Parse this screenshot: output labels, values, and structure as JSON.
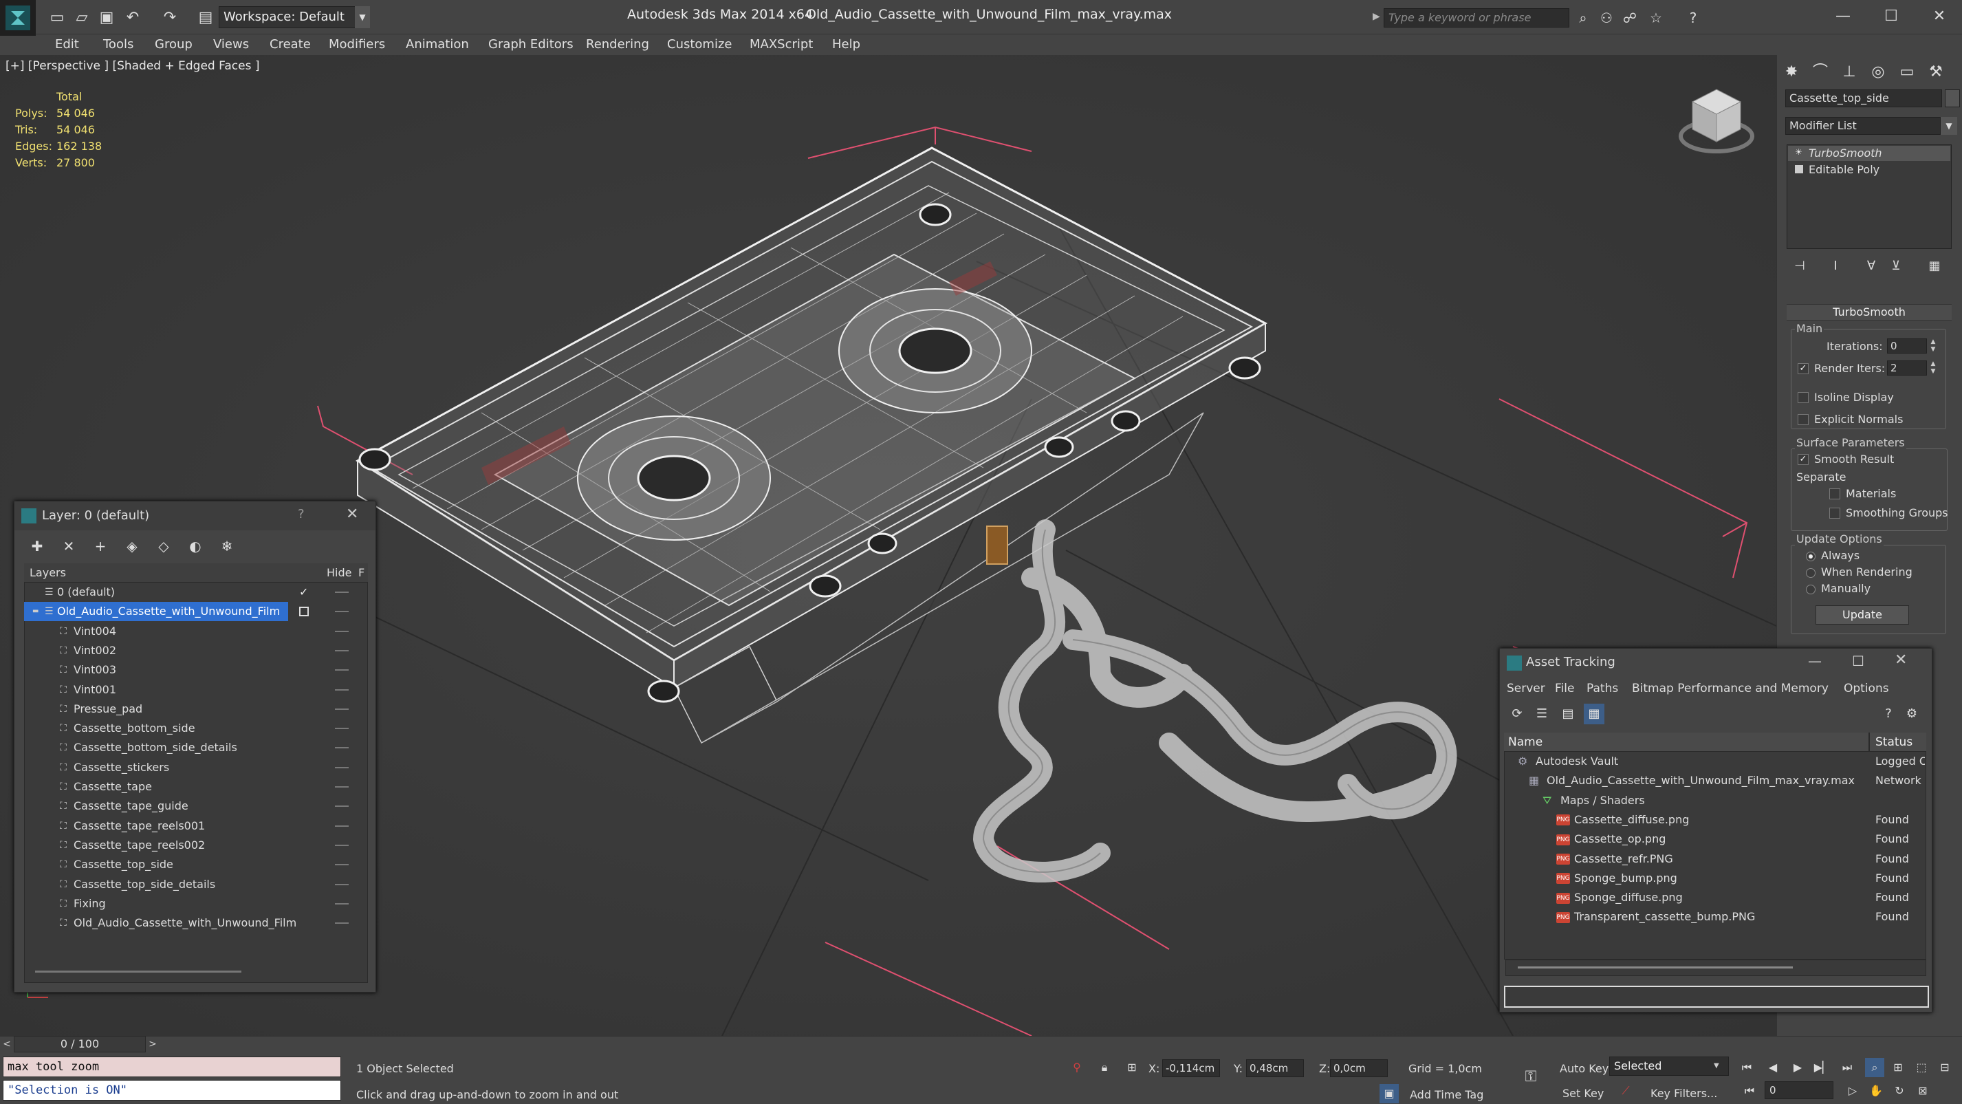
{
  "app": {
    "title": "Autodesk 3ds Max  2014 x64",
    "file": "Old_Audio_Cassette_with_Unwound_Film_max_vray.max",
    "workspace": "Workspace: Default",
    "search_placeholder": "Type a keyword or phrase"
  },
  "menu": [
    "Edit",
    "Tools",
    "Group",
    "Views",
    "Create",
    "Modifiers",
    "Animation",
    "Graph Editors",
    "Rendering",
    "Customize",
    "MAXScript",
    "Help"
  ],
  "viewport": {
    "label": "[+] [Perspective ] [Shaded + Edged Faces ]",
    "stats": {
      "header": "Total",
      "rows": [
        {
          "label": "Polys:",
          "value": "54 046"
        },
        {
          "label": "Tris:",
          "value": "54 046"
        },
        {
          "label": "Edges:",
          "value": "162 138"
        },
        {
          "label": "Verts:",
          "value": "27 800"
        }
      ]
    }
  },
  "command_panel": {
    "object_name": "Cassette_top_side",
    "modifier_list": "Modifier List",
    "stack": [
      "TurboSmooth",
      "Editable Poly"
    ],
    "rollout_title": "TurboSmooth",
    "main_group": "Main",
    "iterations_label": "Iterations:",
    "iterations_value": "0",
    "render_iters_label": "Render Iters:",
    "render_iters_value": "2",
    "isoline_label": "Isoline Display",
    "explicit_normals_label": "Explicit Normals",
    "surface_group": "Surface Parameters",
    "smooth_result_label": "Smooth Result",
    "separate_label": "Separate",
    "materials_label": "Materials",
    "smoothing_groups_label": "Smoothing Groups",
    "update_group": "Update Options",
    "always_label": "Always",
    "when_rendering_label": "When Rendering",
    "manually_label": "Manually",
    "update_button": "Update"
  },
  "layer_window": {
    "title": "Layer: 0 (default)",
    "help": "?",
    "col_layers": "Layers",
    "col_hide": "Hide",
    "col_f": "F",
    "rows": [
      {
        "name": "0 (default)",
        "level": 0
      },
      {
        "name": "Old_Audio_Cassette_with_Unwound_Film",
        "level": 0
      },
      {
        "name": "Vint004",
        "level": 1
      },
      {
        "name": "Vint002",
        "level": 1
      },
      {
        "name": "Vint003",
        "level": 1
      },
      {
        "name": "Vint001",
        "level": 1
      },
      {
        "name": "Pressue_pad",
        "level": 1
      },
      {
        "name": "Cassette_bottom_side",
        "level": 1
      },
      {
        "name": "Cassette_bottom_side_details",
        "level": 1
      },
      {
        "name": "Cassette_stickers",
        "level": 1
      },
      {
        "name": "Cassette_tape",
        "level": 1
      },
      {
        "name": "Cassette_tape_guide",
        "level": 1
      },
      {
        "name": "Cassette_tape_reels001",
        "level": 1
      },
      {
        "name": "Cassette_tape_reels002",
        "level": 1
      },
      {
        "name": "Cassette_top_side",
        "level": 1
      },
      {
        "name": "Cassette_top_side_details",
        "level": 1
      },
      {
        "name": "Fixing",
        "level": 1
      },
      {
        "name": "Old_Audio_Cassette_with_Unwound_Film",
        "level": 1
      }
    ]
  },
  "asset_window": {
    "title": "Asset Tracking",
    "menu": [
      "Server",
      "File",
      "Paths",
      "Bitmap Performance and Memory",
      "Options"
    ],
    "col_name": "Name",
    "col_status": "Status",
    "rows": [
      {
        "name": "Autodesk Vault",
        "status": "Logged O",
        "level": 0,
        "kind": "vault"
      },
      {
        "name": "Old_Audio_Cassette_with_Unwound_Film_max_vray.max",
        "status": "Network",
        "level": 1,
        "kind": "max"
      },
      {
        "name": "Maps / Shaders",
        "status": "",
        "level": 2,
        "kind": "maps"
      },
      {
        "name": "Cassette_diffuse.png",
        "status": "Found",
        "level": 3,
        "kind": "png"
      },
      {
        "name": "Cassette_op.png",
        "status": "Found",
        "level": 3,
        "kind": "png"
      },
      {
        "name": "Cassette_refr.PNG",
        "status": "Found",
        "level": 3,
        "kind": "png"
      },
      {
        "name": "Sponge_bump.png",
        "status": "Found",
        "level": 3,
        "kind": "png"
      },
      {
        "name": "Sponge_diffuse.png",
        "status": "Found",
        "level": 3,
        "kind": "png"
      },
      {
        "name": "Transparent_cassette_bump.PNG",
        "status": "Found",
        "level": 3,
        "kind": "png"
      }
    ],
    "png_badge": "PNG"
  },
  "status": {
    "time_slider": "0 / 100",
    "maxscript_line1": "max tool zoom",
    "maxscript_line2": "\"Selection is ON\"",
    "selection_count": "1 Object Selected",
    "prompt": "Click and drag up-and-down to zoom in and out",
    "x_label": "X:",
    "x_value": "-0,114cm",
    "y_label": "Y:",
    "y_value": "0,48cm",
    "z_label": "Z:",
    "z_value": "0,0cm",
    "grid": "Grid = 1,0cm",
    "add_time_tag": "Add Time Tag",
    "auto_key": "Auto Key",
    "set_key": "Set Key",
    "selected": "Selected",
    "key_filters": "Key Filters...",
    "frame": "0"
  }
}
